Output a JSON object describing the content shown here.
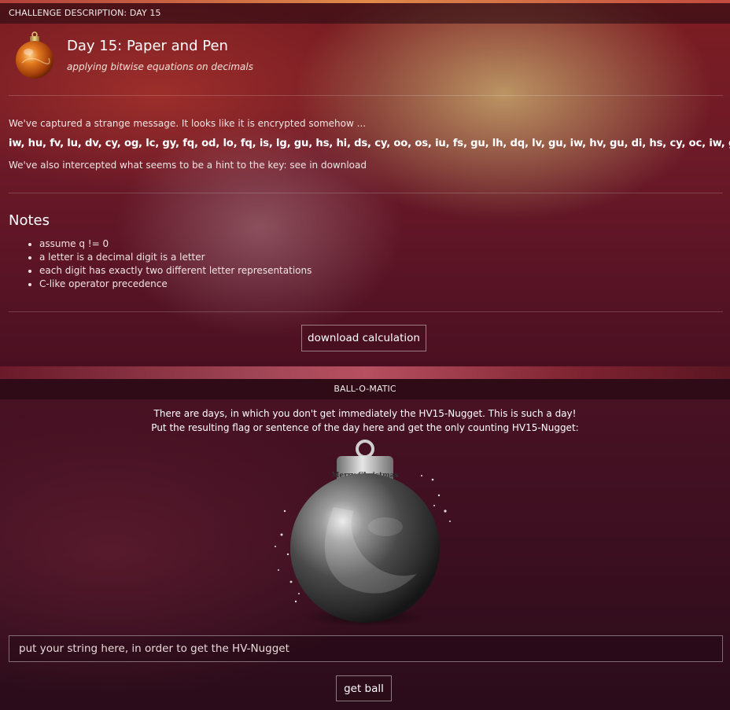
{
  "challenge": {
    "header": "CHALLENGE DESCRIPTION: DAY 15",
    "title": "Day 15: Paper and Pen",
    "subtitle": "applying bitwise equations on decimals",
    "intro": "We've captured a strange message. It looks like it is encrypted somehow ...",
    "cipher": "iw, hu, fv, lu, dv, cy, og, lc, gy, fq, od, lo, fq, is, lg, gu, hs, hi, ds, cy, oo, os, iu, fs, gu, lh, dq, lv, gu, iw, hv, gu, di, hs, cy, oc, iw, gc",
    "hint": "We've also intercepted what seems to be a hint to the key: see in download",
    "notes_title": "Notes",
    "notes": [
      "assume q != 0",
      "a letter is a decimal digit is a letter",
      "each digit has exactly two different letter representations",
      "C-like operator precedence"
    ],
    "download_label": "download calculation"
  },
  "ballomatic": {
    "header": "BALL-O-MATIC",
    "line1": "There are days, in which you don't get immediately the HV15-Nugget. This is such a day!",
    "line2": "Put the resulting flag or sentence of the day here and get the only counting HV15-Nugget:",
    "ball_label": "Merry Christmas",
    "input_placeholder": "put your string here, in order to get the HV-Nugget",
    "input_value": "",
    "submit_label": "get ball"
  },
  "colors": {
    "accent_top": "#e08a4a",
    "ornament": "#d96a1c",
    "ball": "#555555"
  }
}
